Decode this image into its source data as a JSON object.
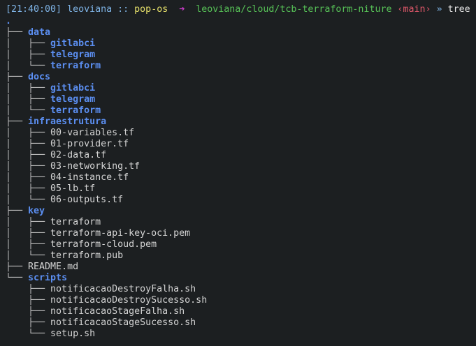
{
  "prompt": {
    "time": "[21:40:00]",
    "user": "leoviana",
    "separator": "::",
    "host": "pop-os",
    "arrow": "➜",
    "path": "leoviana/cloud/tcb-terraform-niture",
    "branch": "‹main›",
    "chevron": "»",
    "command": "tree"
  },
  "colors": {
    "directory": "#5b8ef0",
    "file": "#d4d4d4",
    "host": "#e8e26b",
    "path": "#57c257",
    "branch": "#e0586a",
    "arrow": "#c63cc6"
  },
  "tree": {
    "root": ".",
    "lines": [
      {
        "prefix": "├── ",
        "name": "data",
        "type": "dir"
      },
      {
        "prefix": "│   ├── ",
        "name": "gitlabci",
        "type": "dir"
      },
      {
        "prefix": "│   ├── ",
        "name": "telegram",
        "type": "dir"
      },
      {
        "prefix": "│   └── ",
        "name": "terraform",
        "type": "dir"
      },
      {
        "prefix": "├── ",
        "name": "docs",
        "type": "dir"
      },
      {
        "prefix": "│   ├── ",
        "name": "gitlabci",
        "type": "dir"
      },
      {
        "prefix": "│   ├── ",
        "name": "telegram",
        "type": "dir"
      },
      {
        "prefix": "│   └── ",
        "name": "terraform",
        "type": "dir"
      },
      {
        "prefix": "├── ",
        "name": "infraestrutura",
        "type": "dir"
      },
      {
        "prefix": "│   ├── ",
        "name": "00-variables.tf",
        "type": "file"
      },
      {
        "prefix": "│   ├── ",
        "name": "01-provider.tf",
        "type": "file"
      },
      {
        "prefix": "│   ├── ",
        "name": "02-data.tf",
        "type": "file"
      },
      {
        "prefix": "│   ├── ",
        "name": "03-networking.tf",
        "type": "file"
      },
      {
        "prefix": "│   ├── ",
        "name": "04-instance.tf",
        "type": "file"
      },
      {
        "prefix": "│   ├── ",
        "name": "05-lb.tf",
        "type": "file"
      },
      {
        "prefix": "│   └── ",
        "name": "06-outputs.tf",
        "type": "file"
      },
      {
        "prefix": "├── ",
        "name": "key",
        "type": "dir"
      },
      {
        "prefix": "│   ├── ",
        "name": "terraform",
        "type": "file"
      },
      {
        "prefix": "│   ├── ",
        "name": "terraform-api-key-oci.pem",
        "type": "file"
      },
      {
        "prefix": "│   ├── ",
        "name": "terraform-cloud.pem",
        "type": "file"
      },
      {
        "prefix": "│   └── ",
        "name": "terraform.pub",
        "type": "file"
      },
      {
        "prefix": "├── ",
        "name": "README.md",
        "type": "file"
      },
      {
        "prefix": "└── ",
        "name": "scripts",
        "type": "dir"
      },
      {
        "prefix": "    ├── ",
        "name": "notificacaoDestroyFalha.sh",
        "type": "file"
      },
      {
        "prefix": "    ├── ",
        "name": "notificacaoDestroySucesso.sh",
        "type": "file"
      },
      {
        "prefix": "    ├── ",
        "name": "notificacaoStageFalha.sh",
        "type": "file"
      },
      {
        "prefix": "    ├── ",
        "name": "notificacaoStageSucesso.sh",
        "type": "file"
      },
      {
        "prefix": "    └── ",
        "name": "setup.sh",
        "type": "file"
      }
    ]
  }
}
